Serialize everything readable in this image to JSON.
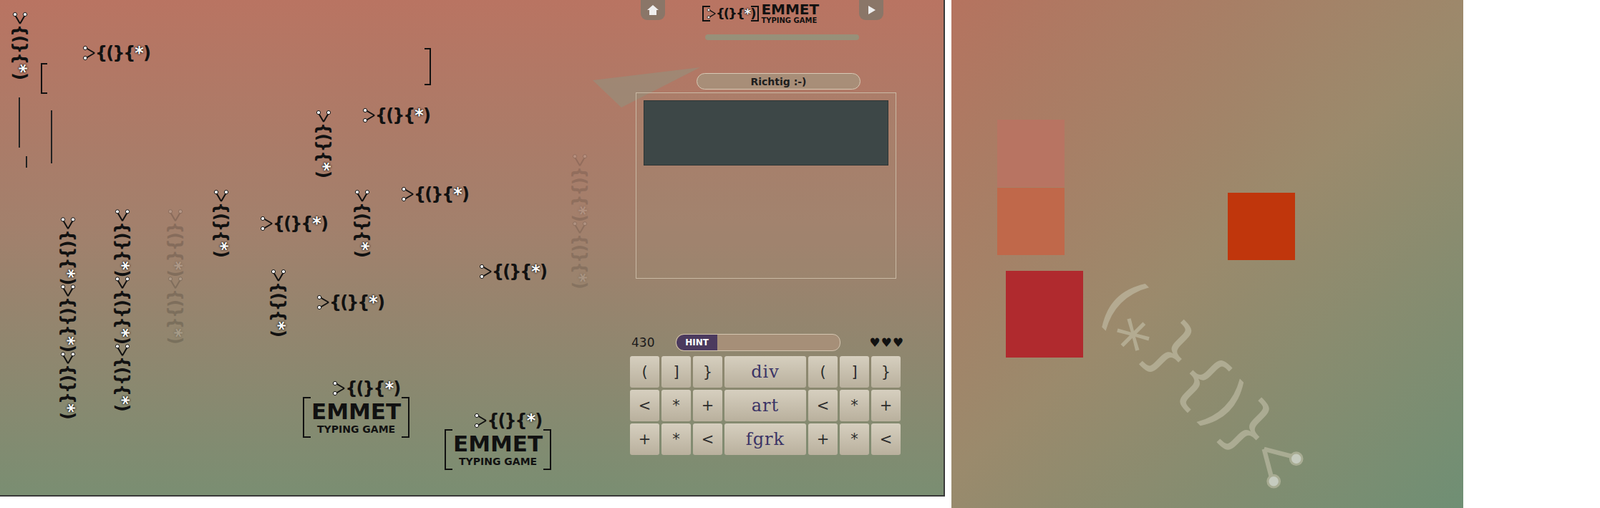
{
  "logo": {
    "mark": "{(}{*)",
    "title": "EMMET",
    "subtitle": "TYPING GAME"
  },
  "status": "Richtig :-)",
  "score": "430",
  "hint": {
    "label": "HINT",
    "level": 0.25
  },
  "heart": "♥",
  "lives": [
    {
      "filled": true
    },
    {
      "filled": true
    },
    {
      "filled": true
    }
  ],
  "keys": [
    [
      {
        "label": "(",
        "kind": "symbol"
      },
      {
        "label": "]",
        "kind": "symbol"
      },
      {
        "label": "}",
        "kind": "symbol"
      },
      {
        "label": "div",
        "kind": "word"
      },
      {
        "label": "(",
        "kind": "symbol"
      },
      {
        "label": "]",
        "kind": "symbol"
      },
      {
        "label": "}",
        "kind": "symbol"
      }
    ],
    [
      {
        "label": "<",
        "kind": "symbol"
      },
      {
        "label": "*",
        "kind": "symbol"
      },
      {
        "label": "+",
        "kind": "symbol"
      },
      {
        "label": "art",
        "kind": "word"
      },
      {
        "label": "<",
        "kind": "symbol"
      },
      {
        "label": "*",
        "kind": "symbol"
      },
      {
        "label": "+",
        "kind": "symbol"
      }
    ],
    [
      {
        "label": "+",
        "kind": "symbol"
      },
      {
        "label": "*",
        "kind": "symbol"
      },
      {
        "label": "<",
        "kind": "symbol"
      },
      {
        "label": "fgrk",
        "kind": "word"
      },
      {
        "label": "+",
        "kind": "symbol"
      },
      {
        "label": "*",
        "kind": "symbol"
      },
      {
        "label": "<",
        "kind": "symbol"
      }
    ]
  ],
  "squares": [
    {
      "color": "#b87462"
    },
    {
      "color": "#c0684a"
    },
    {
      "color": "#b02a2e"
    },
    {
      "color": "#c0360c"
    }
  ]
}
